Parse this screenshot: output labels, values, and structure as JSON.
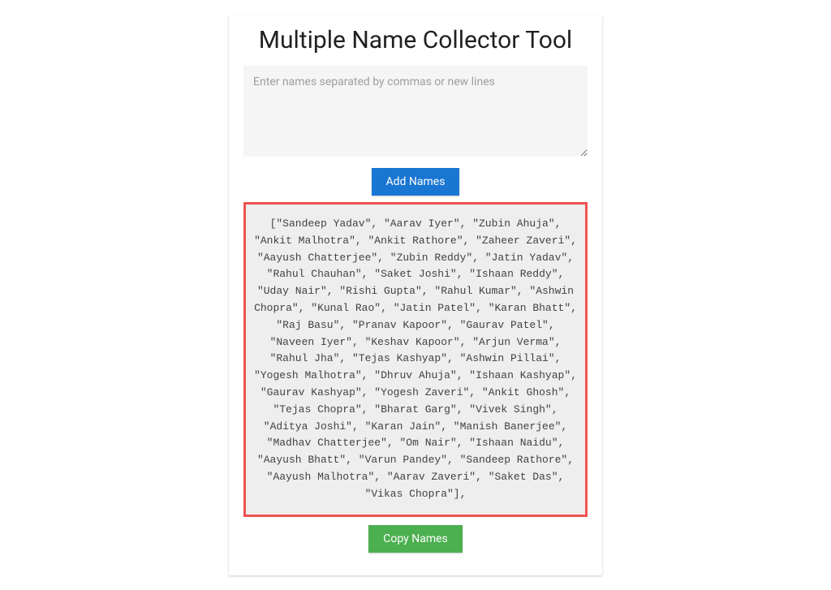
{
  "title": "Multiple Name Collector Tool",
  "input": {
    "placeholder": "Enter names separated by commas or new lines"
  },
  "buttons": {
    "add": "Add Names",
    "copy": "Copy Names"
  },
  "output": "[\"Sandeep Yadav\", \"Aarav Iyer\", \"Zubin Ahuja\", \"Ankit Malhotra\", \"Ankit Rathore\", \"Zaheer Zaveri\", \"Aayush Chatterjee\", \"Zubin Reddy\", \"Jatin Yadav\", \"Rahul Chauhan\", \"Saket Joshi\", \"Ishaan Reddy\", \"Uday Nair\", \"Rishi Gupta\", \"Rahul Kumar\", \"Ashwin Chopra\", \"Kunal Rao\", \"Jatin Patel\", \"Karan Bhatt\", \"Raj Basu\", \"Pranav Kapoor\", \"Gaurav Patel\", \"Naveen Iyer\", \"Keshav Kapoor\", \"Arjun Verma\", \"Rahul Jha\", \"Tejas Kashyap\", \"Ashwin Pillai\", \"Yogesh Malhotra\", \"Dhruv Ahuja\", \"Ishaan Kashyap\", \"Gaurav Kashyap\", \"Yogesh Zaveri\", \"Ankit Ghosh\", \"Tejas Chopra\", \"Bharat Garg\", \"Vivek Singh\", \"Aditya Joshi\", \"Karan Jain\", \"Manish Banerjee\", \"Madhav Chatterjee\", \"Om Nair\", \"Ishaan Naidu\", \"Aayush Bhatt\", \"Varun Pandey\", \"Sandeep Rathore\", \"Aayush Malhotra\", \"Aarav Zaveri\", \"Saket Das\", \"Vikas Chopra\"],"
}
